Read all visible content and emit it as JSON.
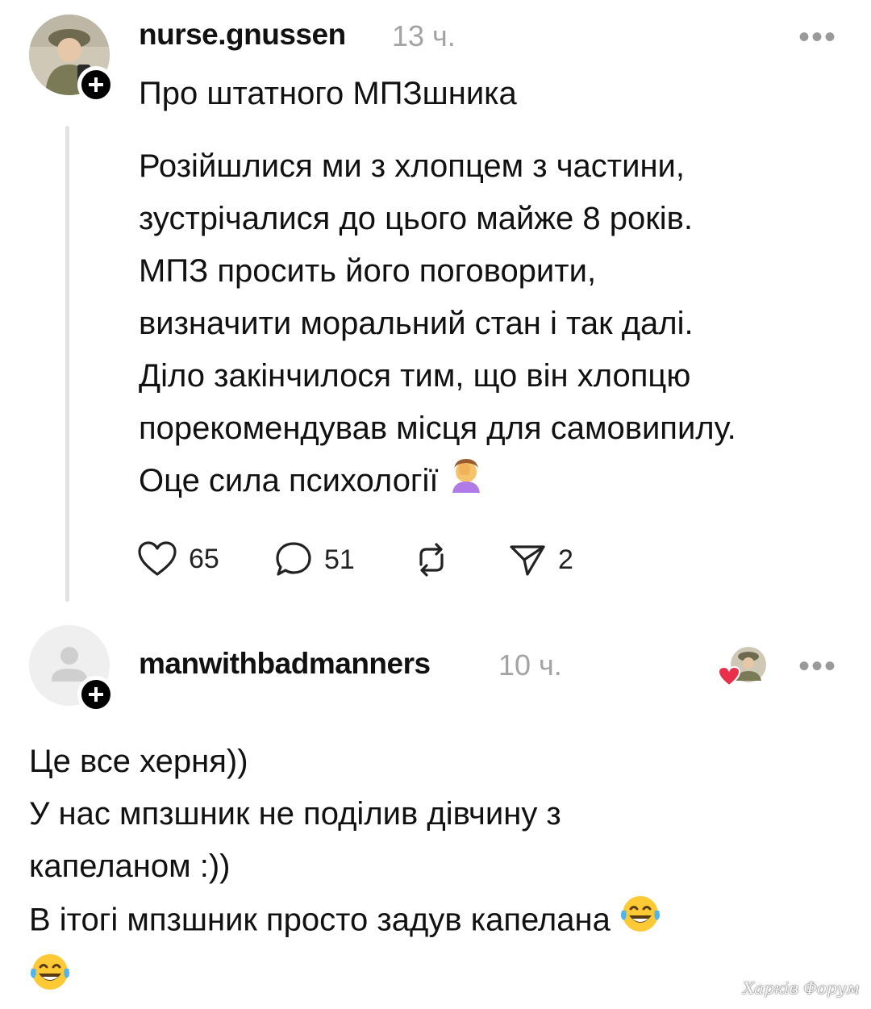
{
  "post": {
    "username": "nurse.gnussen",
    "time": "13 ч.",
    "title": "Про штатного МПЗшника",
    "body_lines": [
      "Розійшлися ми з хлопцем з частини,",
      "зустрічалися до цього майже 8 років.",
      "МПЗ просить його поговорити,",
      "визначити моральний стан і так далі.",
      "Діло закінчилося тим, що він хлопцю",
      "порекомендував місця для самовипилу.",
      "Оце сила психології"
    ],
    "likes": "65",
    "comments": "51",
    "shares": "2",
    "more_label": "•••"
  },
  "reply": {
    "username": "manwithbadmanners",
    "time": "10 ч.",
    "more_label": "•••",
    "body_lines": [
      "Це все херня))",
      "У нас мпзшник не поділив дівчину з",
      "капеланом :))",
      "В ітогі мпзшник просто задув капелана"
    ]
  },
  "watermark": "Харків Форум",
  "icons": {
    "like": "heart-outline-icon",
    "comment": "speech-bubble-icon",
    "repost": "repost-arrows-icon",
    "share": "paper-plane-icon",
    "facepalm": "facepalm-emoji",
    "laugh": "tears-of-joy-emoji"
  },
  "colors": {
    "text": "#111111",
    "muted": "#a3a3a3",
    "thread_line": "#e2e2e2",
    "heart_badge": "#e8304a"
  }
}
